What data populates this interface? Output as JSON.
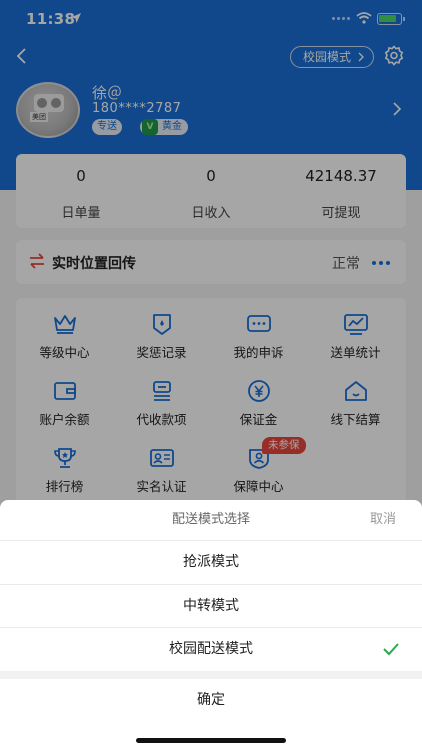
{
  "status_bar": {
    "time": "11:38"
  },
  "header": {
    "mode_label": "校园模式",
    "user_name": "徐＠",
    "phone": "180****2787",
    "badge_delivery": "专送",
    "badge_level": "黄金",
    "badge_level_icon_text": "V"
  },
  "stats": [
    {
      "value": "0",
      "label": "日单量"
    },
    {
      "value": "0",
      "label": "日收入"
    },
    {
      "value": "42148.37",
      "label": "可提现"
    }
  ],
  "realtime": {
    "title": "实时位置回传",
    "status": "正常"
  },
  "grid": [
    {
      "label": "等级中心",
      "icon": "crown-icon"
    },
    {
      "label": "奖惩记录",
      "icon": "shield-badge-icon"
    },
    {
      "label": "我的申诉",
      "icon": "chat-dots-icon"
    },
    {
      "label": "送单统计",
      "icon": "chart-icon"
    },
    {
      "label": "账户余额",
      "icon": "wallet-icon"
    },
    {
      "label": "代收款项",
      "icon": "collect-icon"
    },
    {
      "label": "保证金",
      "icon": "yen-icon"
    },
    {
      "label": "线下结算",
      "icon": "home-icon"
    },
    {
      "label": "排行榜",
      "icon": "trophy-icon"
    },
    {
      "label": "实名认证",
      "icon": "id-card-icon"
    },
    {
      "label": "保障中心",
      "icon": "guard-icon"
    }
  ],
  "uninsured_badge": "未参保",
  "sheet": {
    "title": "配送模式选择",
    "cancel": "取消",
    "options": [
      {
        "label": "抢派模式",
        "selected": false
      },
      {
        "label": "中转模式",
        "selected": false
      },
      {
        "label": "校园配送模式",
        "selected": true
      }
    ],
    "confirm": "确定"
  },
  "colors": {
    "brand": "#1a6fd6",
    "check": "#2aa84a",
    "badge_red": "#e8453c"
  }
}
